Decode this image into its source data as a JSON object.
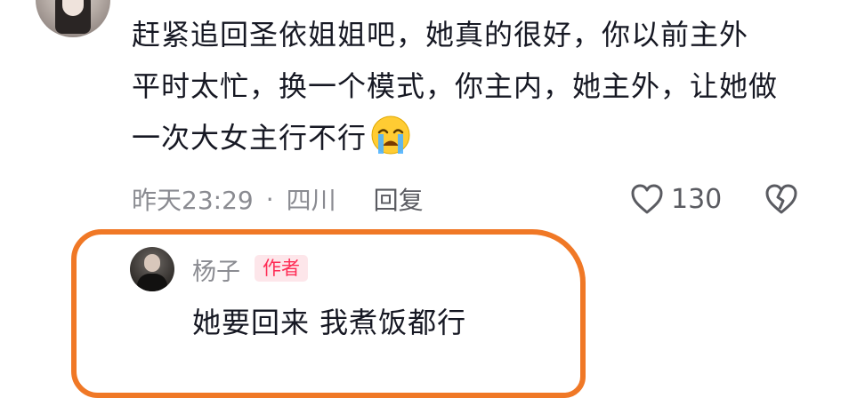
{
  "comment": {
    "lines": [
      "赶紧追回圣依姐姐吧，她真的很好，你以前主外",
      "平时太忙，换一个模式，你主内，她主外，让她做",
      "一次大女主行不行"
    ],
    "emoji": "crying-face",
    "time": "昨天23:29",
    "separator": "·",
    "location": "四川",
    "reply_label": "回复",
    "likes": "130"
  },
  "reply": {
    "username": "杨子",
    "badge": "作者",
    "text": "她要回来 我煮饭都行"
  },
  "colors": {
    "highlight": "#f07826",
    "badge_text": "#fe2c55",
    "badge_bg": "#fde6ea",
    "meta": "#8a8b91"
  }
}
